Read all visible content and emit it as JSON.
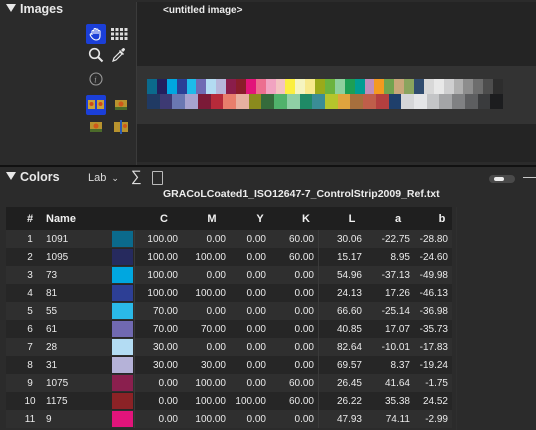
{
  "images_panel": {
    "title": "Images",
    "image_title": "<untitled image>",
    "tools": [
      "hand-icon",
      "grid-icon",
      "zoom-icon",
      "eyedropper-icon",
      "info-icon",
      "compare-images-icon",
      "image-thumb-icon",
      "image-thumb-icon",
      "split-image-icon"
    ],
    "strip_top": [
      "#0b6a8c",
      "#231f5e",
      "#00a7e0",
      "#2a3f96",
      "#1ebbea",
      "#6f6ab3",
      "#b3dbf2",
      "#b7b6da",
      "#8a1d4a",
      "#8a1d2a",
      "#e2147a",
      "#ec6e8f",
      "#f1a3c1",
      "#f3c3c1",
      "#fbef3f",
      "#f5f4c0",
      "#f7e98d",
      "#9aaa1a",
      "#6bb33e",
      "#8ed09d",
      "#1d9f54",
      "#009d93",
      "#c08fba",
      "#f49a1f",
      "#71a34f",
      "#c8a77a",
      "#8aa45e",
      "#304c6f",
      "#d8d8d8",
      "#e8e8e8",
      "#cfcfd0",
      "#b0b0b0",
      "#8d8d8d",
      "#6d6d6d",
      "#4d4d4d",
      "#2d2d2d"
    ],
    "strip_bottom": [
      "#203a63",
      "#3d3a73",
      "#6a78b2",
      "#a7a3cf",
      "#7b1a37",
      "#b62a3a",
      "#e87e6c",
      "#e7b0a0",
      "#8b8b1d",
      "#356b3b",
      "#50b26b",
      "#8fcfa5",
      "#1f8a66",
      "#3a8d96",
      "#b6c52c",
      "#e0a43e",
      "#a76f3d",
      "#c05e4a",
      "#b43f3f",
      "#1f3f6b",
      "#d5d6d8",
      "#e4e5e7",
      "#c4c5c7",
      "#a4a5a7",
      "#808183",
      "#5d5e60",
      "#3a3b3d",
      "#1c1d1f"
    ]
  },
  "colors_panel": {
    "title": "Colors",
    "mode": "Lab",
    "sigma": "∑",
    "filename": "GRACoLCoated1_ISO12647-7_ControlStrip2009_Ref.txt",
    "columns": [
      "#",
      "Name",
      "",
      "C",
      "M",
      "Y",
      "K",
      "L",
      "a",
      "b"
    ],
    "rows": [
      {
        "n": "1",
        "name": "1091",
        "color": "#0b6a8c",
        "c": "100.00",
        "m": "0.00",
        "y": "0.00",
        "k": "60.00",
        "l": "30.06",
        "a": "-22.75",
        "b": "-28.80"
      },
      {
        "n": "2",
        "name": "1095",
        "color": "#262a5e",
        "c": "100.00",
        "m": "100.00",
        "y": "0.00",
        "k": "60.00",
        "l": "15.17",
        "a": "8.95",
        "b": "-24.60"
      },
      {
        "n": "3",
        "name": "73",
        "color": "#00a7e0",
        "c": "100.00",
        "m": "0.00",
        "y": "0.00",
        "k": "0.00",
        "l": "54.96",
        "a": "-37.13",
        "b": "-49.98"
      },
      {
        "n": "4",
        "name": "81",
        "color": "#2d3f95",
        "c": "100.00",
        "m": "100.00",
        "y": "0.00",
        "k": "0.00",
        "l": "24.13",
        "a": "17.26",
        "b": "-46.13"
      },
      {
        "n": "5",
        "name": "55",
        "color": "#2ab9e8",
        "c": "70.00",
        "m": "0.00",
        "y": "0.00",
        "k": "0.00",
        "l": "66.60",
        "a": "-25.14",
        "b": "-36.98"
      },
      {
        "n": "6",
        "name": "61",
        "color": "#7069b1",
        "c": "70.00",
        "m": "70.00",
        "y": "0.00",
        "k": "0.00",
        "l": "40.85",
        "a": "17.07",
        "b": "-35.73"
      },
      {
        "n": "7",
        "name": "28",
        "color": "#b3dcf3",
        "c": "30.00",
        "m": "0.00",
        "y": "0.00",
        "k": "0.00",
        "l": "82.64",
        "a": "-10.01",
        "b": "-17.83"
      },
      {
        "n": "8",
        "name": "31",
        "color": "#b5b2d8",
        "c": "30.00",
        "m": "30.00",
        "y": "0.00",
        "k": "0.00",
        "l": "69.57",
        "a": "8.37",
        "b": "-19.24"
      },
      {
        "n": "9",
        "name": "1075",
        "color": "#8a1f4e",
        "c": "0.00",
        "m": "100.00",
        "y": "0.00",
        "k": "60.00",
        "l": "26.45",
        "a": "41.64",
        "b": "-1.75"
      },
      {
        "n": "10",
        "name": "1175",
        "color": "#8b2226",
        "c": "0.00",
        "m": "100.00",
        "y": "100.00",
        "k": "60.00",
        "l": "26.22",
        "a": "35.38",
        "b": "24.52"
      },
      {
        "n": "11",
        "name": "9",
        "color": "#e2147b",
        "c": "0.00",
        "m": "100.00",
        "y": "0.00",
        "k": "0.00",
        "l": "47.93",
        "a": "74.11",
        "b": "-2.99"
      }
    ]
  }
}
